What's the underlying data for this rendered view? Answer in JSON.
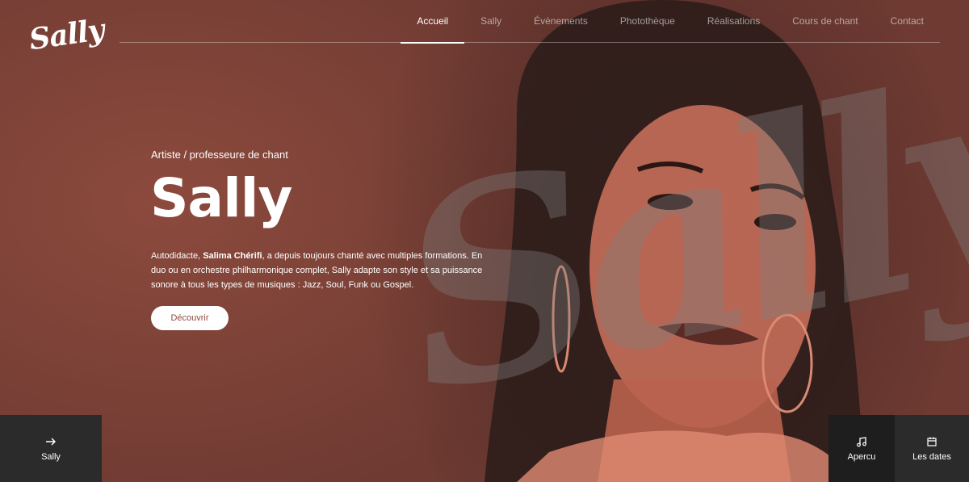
{
  "brand": {
    "logo": "Sally"
  },
  "nav": {
    "items": [
      {
        "label": "Accueil",
        "active": true
      },
      {
        "label": "Sally"
      },
      {
        "label": "Évènements"
      },
      {
        "label": "Photothèque"
      },
      {
        "label": "Réalisations"
      },
      {
        "label": "Cours de chant"
      },
      {
        "label": "Contact"
      }
    ]
  },
  "hero": {
    "eyebrow": "Artiste / professeure de chant",
    "title": "Sally",
    "intro_before": "Autodidacte, ",
    "intro_name": "Salima Chérifi",
    "intro_after": ", a depuis toujours chanté avec multiples formations. En duo ou en orchestre philharmonique complet, Sally adapte son style et sa puissance sonore à tous les types de musiques : Jazz, Soul, Funk ou Gospel.",
    "cta_label": "Découvrir",
    "watermark": "Sally"
  },
  "tiles": {
    "left": {
      "label": "Sally",
      "icon": "arrow-right-icon"
    },
    "apercu": {
      "label": "Apercu",
      "icon": "music-note-icon"
    },
    "dates": {
      "label": "Les dates",
      "icon": "calendar-icon"
    }
  },
  "colors": {
    "accent": "#8c4a3d",
    "tile_dark": "#2a2a2a"
  }
}
